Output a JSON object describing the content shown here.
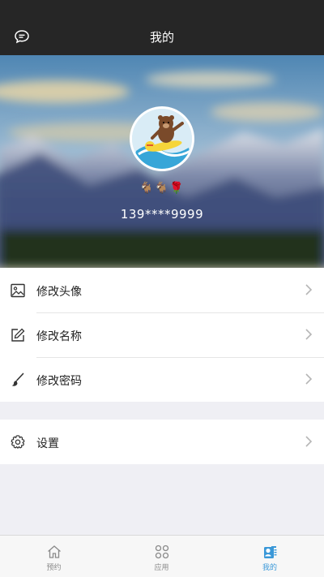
{
  "navbar": {
    "title": "我的",
    "left_icon": "message-bubble-icon"
  },
  "profile": {
    "emoji": "🐐🐐🌹",
    "phone": "139****9999"
  },
  "menu": {
    "group1": [
      {
        "label": "修改头像",
        "icon": "image-icon"
      },
      {
        "label": "修改名称",
        "icon": "edit-icon"
      },
      {
        "label": "修改密码",
        "icon": "brush-icon"
      }
    ],
    "group2": [
      {
        "label": "设置",
        "icon": "gear-icon"
      }
    ]
  },
  "tabbar": {
    "tabs": [
      {
        "label": "预约",
        "icon": "home-icon"
      },
      {
        "label": "应用",
        "icon": "apps-grid-icon"
      },
      {
        "label": "我的",
        "icon": "profile-card-icon"
      }
    ],
    "active_index": 2,
    "active_color": "#3a98d8"
  }
}
